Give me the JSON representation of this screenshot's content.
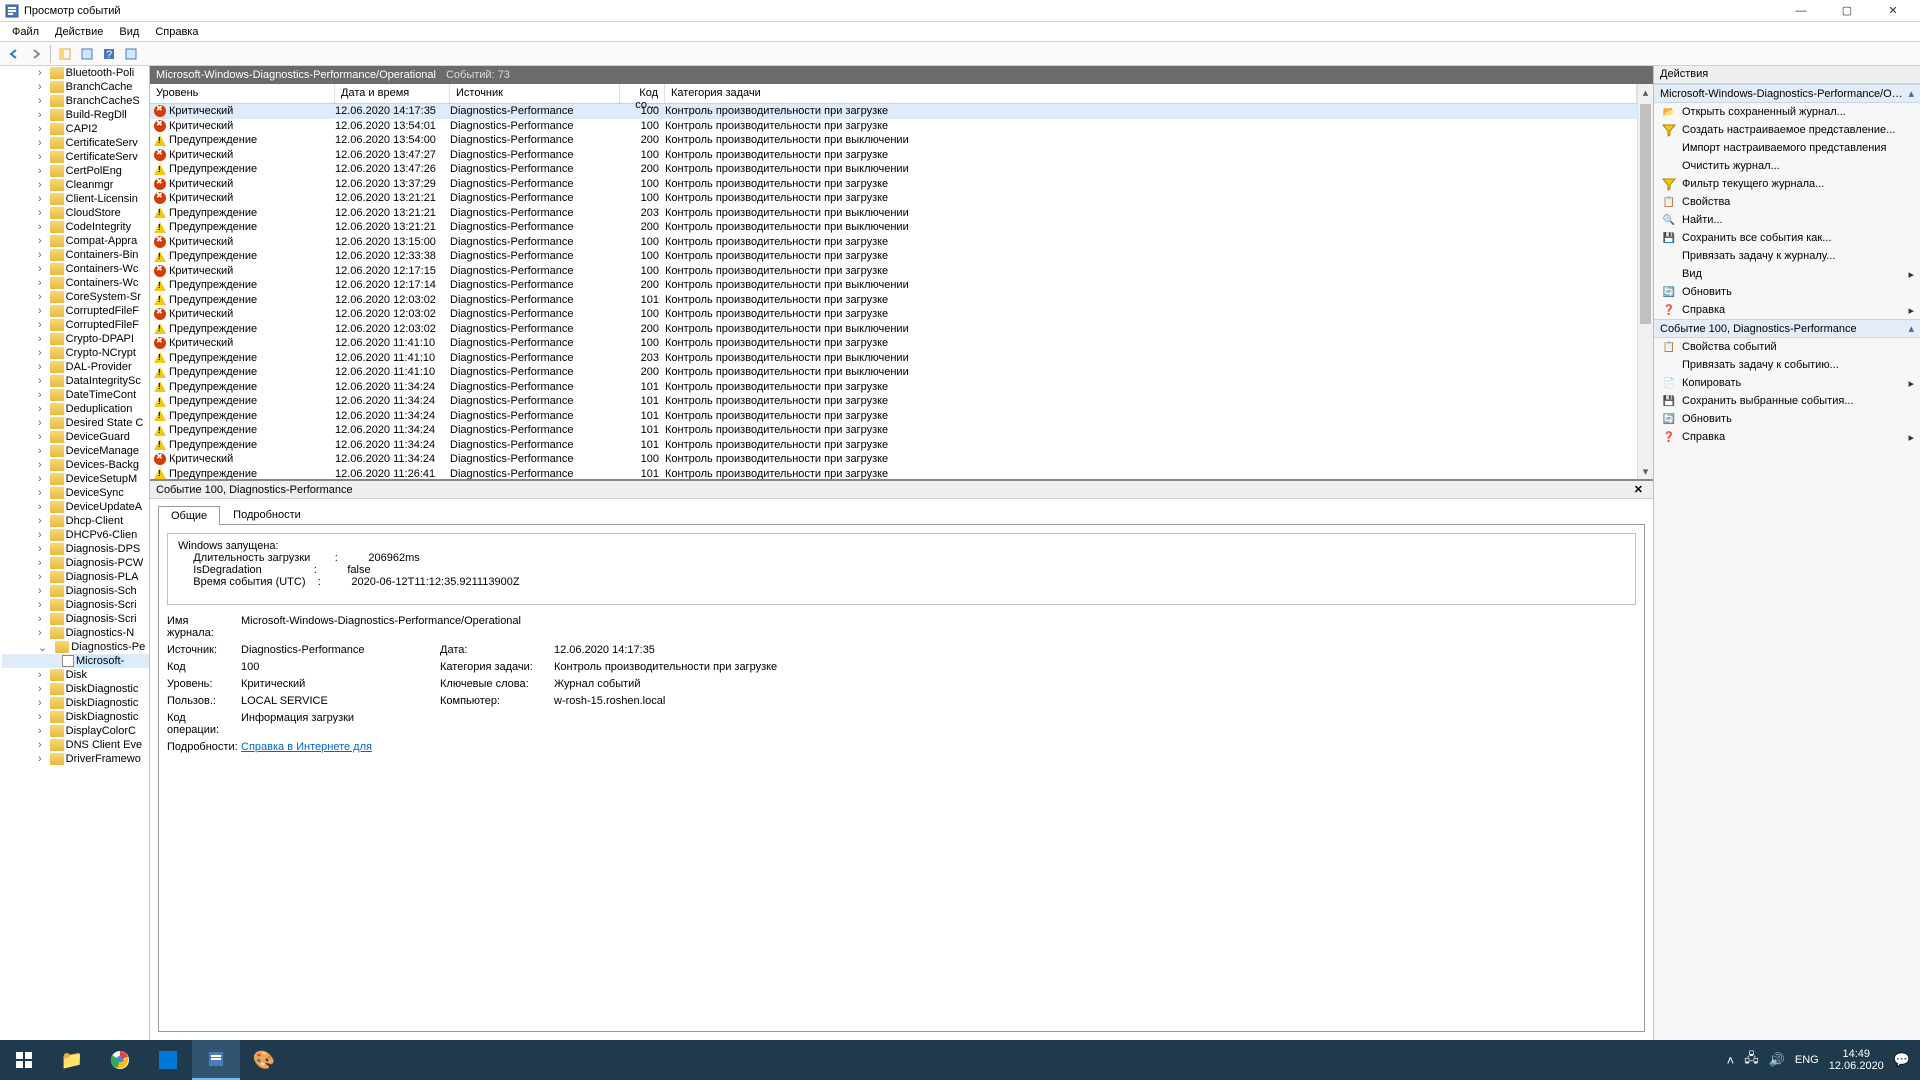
{
  "window": {
    "title": "Просмотр событий"
  },
  "menu": [
    "Файл",
    "Действие",
    "Вид",
    "Справка"
  ],
  "tree": [
    {
      "label": "Bluetooth-Poli",
      "expand": true
    },
    {
      "label": "BranchCache",
      "expand": true
    },
    {
      "label": "BranchCacheS",
      "expand": true
    },
    {
      "label": "Build-RegDll",
      "expand": true
    },
    {
      "label": "CAPI2",
      "expand": true
    },
    {
      "label": "CertificateServ",
      "expand": true
    },
    {
      "label": "CertificateServ",
      "expand": true
    },
    {
      "label": "CertPolEng",
      "expand": true
    },
    {
      "label": "Cleanmgr",
      "expand": true
    },
    {
      "label": "Client-Licensin",
      "expand": true
    },
    {
      "label": "CloudStore",
      "expand": true
    },
    {
      "label": "CodeIntegrity",
      "expand": true
    },
    {
      "label": "Compat-Appra",
      "expand": true
    },
    {
      "label": "Containers-Bin",
      "expand": true
    },
    {
      "label": "Containers-Wc",
      "expand": true
    },
    {
      "label": "Containers-Wc",
      "expand": true
    },
    {
      "label": "CoreSystem-Sr",
      "expand": true
    },
    {
      "label": "CorruptedFileF",
      "expand": true
    },
    {
      "label": "CorruptedFileF",
      "expand": true
    },
    {
      "label": "Crypto-DPAPI",
      "expand": true
    },
    {
      "label": "Crypto-NCrypt",
      "expand": true
    },
    {
      "label": "DAL-Provider",
      "expand": true
    },
    {
      "label": "DataIntegritySc",
      "expand": true
    },
    {
      "label": "DateTimeCont",
      "expand": true
    },
    {
      "label": "Deduplication",
      "expand": true
    },
    {
      "label": "Desired State C",
      "expand": true
    },
    {
      "label": "DeviceGuard",
      "expand": true
    },
    {
      "label": "DeviceManage",
      "expand": true
    },
    {
      "label": "Devices-Backg",
      "expand": true
    },
    {
      "label": "DeviceSetupM",
      "expand": true
    },
    {
      "label": "DeviceSync",
      "expand": true
    },
    {
      "label": "DeviceUpdateA",
      "expand": true
    },
    {
      "label": "Dhcp-Client",
      "expand": true
    },
    {
      "label": "DHCPv6-Clien",
      "expand": true
    },
    {
      "label": "Diagnosis-DPS",
      "expand": true
    },
    {
      "label": "Diagnosis-PCW",
      "expand": true
    },
    {
      "label": "Diagnosis-PLA",
      "expand": true
    },
    {
      "label": "Diagnosis-Sch",
      "expand": true
    },
    {
      "label": "Diagnosis-Scri",
      "expand": true
    },
    {
      "label": "Diagnosis-Scri",
      "expand": true
    },
    {
      "label": "Diagnostics-N",
      "expand": true
    },
    {
      "label": "Diagnostics-Pe",
      "expand": true,
      "expanded": true
    },
    {
      "label": "Microsoft-",
      "expand": false,
      "indent": 2,
      "selected": true,
      "logico": true
    },
    {
      "label": "Disk",
      "expand": true
    },
    {
      "label": "DiskDiagnostic",
      "expand": true
    },
    {
      "label": "DiskDiagnostic",
      "expand": true
    },
    {
      "label": "DiskDiagnostic",
      "expand": true
    },
    {
      "label": "DisplayColorC",
      "expand": true
    },
    {
      "label": "DNS Client Eve",
      "expand": true
    },
    {
      "label": "DriverFramewo",
      "expand": true
    }
  ],
  "center": {
    "title": "Microsoft-Windows-Diagnostics-Performance/Operational",
    "count": "Событий: 73",
    "columns": {
      "level": "Уровень",
      "date": "Дата и время",
      "source": "Источник",
      "code": "Код со…",
      "cat": "Категория задачи"
    }
  },
  "events": [
    {
      "lvl": "crit",
      "level": "Критический",
      "date": "12.06.2020 14:17:35",
      "src": "Diagnostics-Performance",
      "code": "100",
      "cat": "Контроль производительности при загрузке",
      "sel": true
    },
    {
      "lvl": "crit",
      "level": "Критический",
      "date": "12.06.2020 13:54:01",
      "src": "Diagnostics-Performance",
      "code": "100",
      "cat": "Контроль производительности при загрузке"
    },
    {
      "lvl": "warn",
      "level": "Предупреждение",
      "date": "12.06.2020 13:54:00",
      "src": "Diagnostics-Performance",
      "code": "200",
      "cat": "Контроль производительности при выключении"
    },
    {
      "lvl": "crit",
      "level": "Критический",
      "date": "12.06.2020 13:47:27",
      "src": "Diagnostics-Performance",
      "code": "100",
      "cat": "Контроль производительности при загрузке"
    },
    {
      "lvl": "warn",
      "level": "Предупреждение",
      "date": "12.06.2020 13:47:26",
      "src": "Diagnostics-Performance",
      "code": "200",
      "cat": "Контроль производительности при выключении"
    },
    {
      "lvl": "crit",
      "level": "Критический",
      "date": "12.06.2020 13:37:29",
      "src": "Diagnostics-Performance",
      "code": "100",
      "cat": "Контроль производительности при загрузке"
    },
    {
      "lvl": "crit",
      "level": "Критический",
      "date": "12.06.2020 13:21:21",
      "src": "Diagnostics-Performance",
      "code": "100",
      "cat": "Контроль производительности при загрузке"
    },
    {
      "lvl": "warn",
      "level": "Предупреждение",
      "date": "12.06.2020 13:21:21",
      "src": "Diagnostics-Performance",
      "code": "203",
      "cat": "Контроль производительности при выключении"
    },
    {
      "lvl": "warn",
      "level": "Предупреждение",
      "date": "12.06.2020 13:21:21",
      "src": "Diagnostics-Performance",
      "code": "200",
      "cat": "Контроль производительности при выключении"
    },
    {
      "lvl": "crit",
      "level": "Критический",
      "date": "12.06.2020 13:15:00",
      "src": "Diagnostics-Performance",
      "code": "100",
      "cat": "Контроль производительности при загрузке"
    },
    {
      "lvl": "warn",
      "level": "Предупреждение",
      "date": "12.06.2020 12:33:38",
      "src": "Diagnostics-Performance",
      "code": "100",
      "cat": "Контроль производительности при загрузке"
    },
    {
      "lvl": "crit",
      "level": "Критический",
      "date": "12.06.2020 12:17:15",
      "src": "Diagnostics-Performance",
      "code": "100",
      "cat": "Контроль производительности при загрузке"
    },
    {
      "lvl": "warn",
      "level": "Предупреждение",
      "date": "12.06.2020 12:17:14",
      "src": "Diagnostics-Performance",
      "code": "200",
      "cat": "Контроль производительности при выключении"
    },
    {
      "lvl": "warn",
      "level": "Предупреждение",
      "date": "12.06.2020 12:03:02",
      "src": "Diagnostics-Performance",
      "code": "101",
      "cat": "Контроль производительности при загрузке"
    },
    {
      "lvl": "crit",
      "level": "Критический",
      "date": "12.06.2020 12:03:02",
      "src": "Diagnostics-Performance",
      "code": "100",
      "cat": "Контроль производительности при загрузке"
    },
    {
      "lvl": "warn",
      "level": "Предупреждение",
      "date": "12.06.2020 12:03:02",
      "src": "Diagnostics-Performance",
      "code": "200",
      "cat": "Контроль производительности при выключении"
    },
    {
      "lvl": "crit",
      "level": "Критический",
      "date": "12.06.2020 11:41:10",
      "src": "Diagnostics-Performance",
      "code": "100",
      "cat": "Контроль производительности при загрузке"
    },
    {
      "lvl": "warn",
      "level": "Предупреждение",
      "date": "12.06.2020 11:41:10",
      "src": "Diagnostics-Performance",
      "code": "203",
      "cat": "Контроль производительности при выключении"
    },
    {
      "lvl": "warn",
      "level": "Предупреждение",
      "date": "12.06.2020 11:41:10",
      "src": "Diagnostics-Performance",
      "code": "200",
      "cat": "Контроль производительности при выключении"
    },
    {
      "lvl": "warn",
      "level": "Предупреждение",
      "date": "12.06.2020 11:34:24",
      "src": "Diagnostics-Performance",
      "code": "101",
      "cat": "Контроль производительности при загрузке"
    },
    {
      "lvl": "warn",
      "level": "Предупреждение",
      "date": "12.06.2020 11:34:24",
      "src": "Diagnostics-Performance",
      "code": "101",
      "cat": "Контроль производительности при загрузке"
    },
    {
      "lvl": "warn",
      "level": "Предупреждение",
      "date": "12.06.2020 11:34:24",
      "src": "Diagnostics-Performance",
      "code": "101",
      "cat": "Контроль производительности при загрузке"
    },
    {
      "lvl": "warn",
      "level": "Предупреждение",
      "date": "12.06.2020 11:34:24",
      "src": "Diagnostics-Performance",
      "code": "101",
      "cat": "Контроль производительности при загрузке"
    },
    {
      "lvl": "warn",
      "level": "Предупреждение",
      "date": "12.06.2020 11:34:24",
      "src": "Diagnostics-Performance",
      "code": "101",
      "cat": "Контроль производительности при загрузке"
    },
    {
      "lvl": "crit",
      "level": "Критический",
      "date": "12.06.2020 11:34:24",
      "src": "Diagnostics-Performance",
      "code": "100",
      "cat": "Контроль производительности при загрузке"
    },
    {
      "lvl": "warn",
      "level": "Предупреждение",
      "date": "12.06.2020 11:26:41",
      "src": "Diagnostics-Performance",
      "code": "101",
      "cat": "Контроль производительности при загрузке"
    }
  ],
  "details": {
    "hdr": "Событие 100, Diagnostics-Performance",
    "tabs": {
      "general": "Общие",
      "detail": "Подробности"
    },
    "msg": {
      "l1": "Windows запущена:",
      "l2": "     Длительность загрузки        :          206962ms",
      "l3": "     IsDegradation                 :          false",
      "l4": "     Время события (UTC)    :          2020-06-12T11:12:35.921113900Z"
    },
    "props": {
      "log_lbl": "Имя журнала:",
      "log_val": "Microsoft-Windows-Diagnostics-Performance/Operational",
      "src_lbl": "Источник:",
      "src_val": "Diagnostics-Performance",
      "date_lbl": "Дата:",
      "date_val": "12.06.2020 14:17:35",
      "code_lbl": "Код",
      "code_val": "100",
      "cat_lbl": "Категория задачи:",
      "cat_val": "Контроль производительности при загрузке",
      "lvl_lbl": "Уровень:",
      "lvl_val": "Критический",
      "kw_lbl": "Ключевые слова:",
      "kw_val": "Журнал событий",
      "usr_lbl": "Пользов.:",
      "usr_val": "LOCAL SERVICE",
      "comp_lbl": "Компьютер:",
      "comp_val": "w-rosh-15.roshen.local",
      "op_lbl": "Код операции:",
      "op_val": "Информация загрузки",
      "info_lbl": "Подробности:",
      "info_link": "Справка в Интернете для "
    }
  },
  "actions": {
    "title": "Действия",
    "sec1": "Microsoft-Windows-Diagnostics-Performance/Operational",
    "sec2": "Событие 100, Diagnostics-Performance",
    "items1": [
      {
        "label": "Открыть сохраненный журнал...",
        "icon": "ai-open"
      },
      {
        "label": "Создать настраиваемое представление...",
        "icon": "ai-funnel",
        "funnel": true
      },
      {
        "label": "Импорт настраиваемого представления",
        "icon": ""
      },
      {
        "label": "Очистить журнал...",
        "icon": ""
      },
      {
        "label": "Фильтр текущего журнала...",
        "icon": "ai-funnel",
        "funnel": true
      },
      {
        "label": "Свойства",
        "icon": "ai-props"
      },
      {
        "label": "Найти...",
        "icon": "ai-find"
      },
      {
        "label": "Сохранить все события как...",
        "icon": "ai-save"
      },
      {
        "label": "Привязать задачу к журналу...",
        "icon": ""
      },
      {
        "label": "Вид",
        "icon": "",
        "arrow": true
      },
      {
        "label": "Обновить",
        "icon": "ai-refresh"
      },
      {
        "label": "Справка",
        "icon": "ai-help",
        "arrow": true
      }
    ],
    "items2": [
      {
        "label": "Свойства событий",
        "icon": "ai-props"
      },
      {
        "label": "Привязать задачу к событию...",
        "icon": ""
      },
      {
        "label": "Копировать",
        "icon": "ai-copy",
        "arrow": true
      },
      {
        "label": "Сохранить выбранные события...",
        "icon": "ai-save"
      },
      {
        "label": "Обновить",
        "icon": "ai-refresh"
      },
      {
        "label": "Справка",
        "icon": "ai-help",
        "arrow": true
      }
    ]
  },
  "tray": {
    "lang": "ENG",
    "time": "14:49",
    "date": "12.06.2020"
  }
}
